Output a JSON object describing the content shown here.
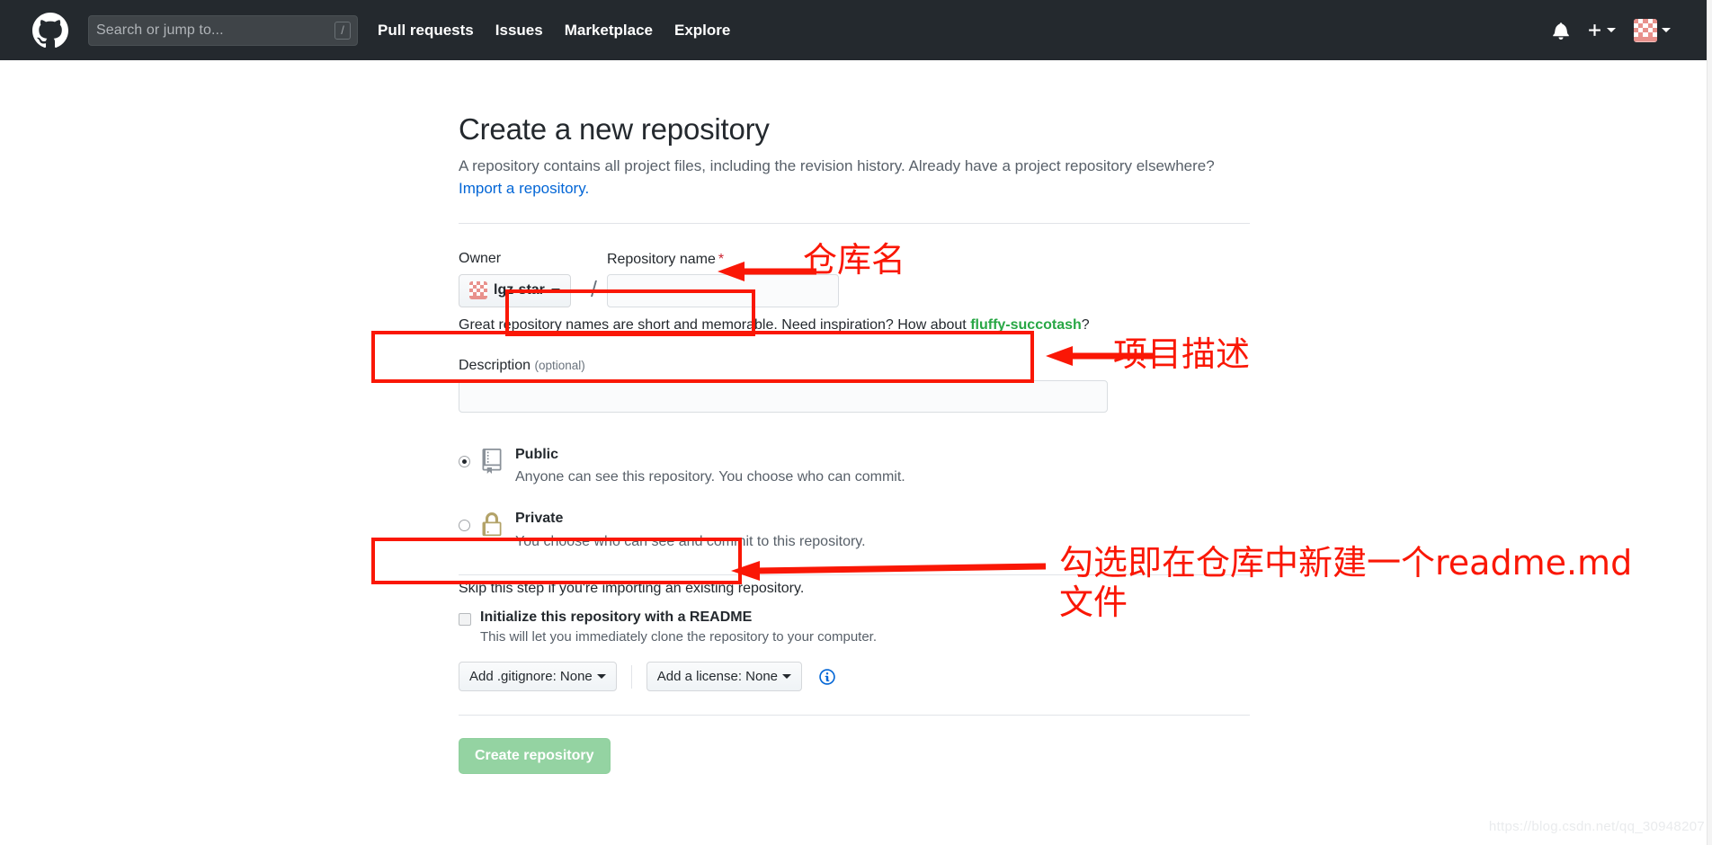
{
  "header": {
    "logo_icon": "github-mark-icon",
    "search": {
      "placeholder": "Search or jump to...",
      "shortcut_key": "/"
    },
    "nav": [
      {
        "label": "Pull requests"
      },
      {
        "label": "Issues"
      },
      {
        "label": "Marketplace"
      },
      {
        "label": "Explore"
      }
    ],
    "right": {
      "notifications_icon": "bell-icon",
      "create_new_icon": "plus-icon",
      "avatar_icon": "user-avatar-identicon",
      "caret_icon": "chevron-down-icon"
    },
    "background_color": "#24292e"
  },
  "main": {
    "title": "Create a new repository",
    "lead": "A repository contains all project files, including the revision history. Already have a project repository elsewhere?",
    "import_link": "Import a repository.",
    "owner": {
      "label": "Owner",
      "selected": "lgz-star",
      "separator": "/"
    },
    "repo_name": {
      "label": "Repository name",
      "required_mark": "*",
      "value": "",
      "placeholder": ""
    },
    "name_hint_prefix": "Great repository names are short and memorable. Need inspiration? How about ",
    "name_hint_suggestion": "fluffy-succotash",
    "name_hint_suffix": "?",
    "description": {
      "label": "Description",
      "optional": "(optional)",
      "value": "",
      "placeholder": ""
    },
    "visibility": [
      {
        "value": "public",
        "title": "Public",
        "desc": "Anyone can see this repository. You choose who can commit.",
        "icon": "repo-book-icon",
        "selected": true
      },
      {
        "value": "private",
        "title": "Private",
        "desc": "You choose who can see and commit to this repository.",
        "icon": "lock-icon",
        "selected": false
      }
    ],
    "skip_text": "Skip this step if you're importing an existing repository.",
    "readme": {
      "title": "Initialize this repository with a README",
      "desc": "This will let you immediately clone the repository to your computer.",
      "checked": false
    },
    "gitignore_button": "Add .gitignore: None",
    "license_button": "Add a license: None",
    "info_icon": "info-circle-icon",
    "create_button": "Create repository",
    "accent_green": "#28a745",
    "create_button_color": "#94d3a2"
  },
  "annotations": {
    "color": "#fa1705",
    "items": [
      {
        "text": "仓库名"
      },
      {
        "text": "项目描述"
      },
      {
        "text": "勾选即在仓库中新建一个readme.md\n文件"
      }
    ]
  },
  "watermark": "https://blog.csdn.net/qq_30948207"
}
